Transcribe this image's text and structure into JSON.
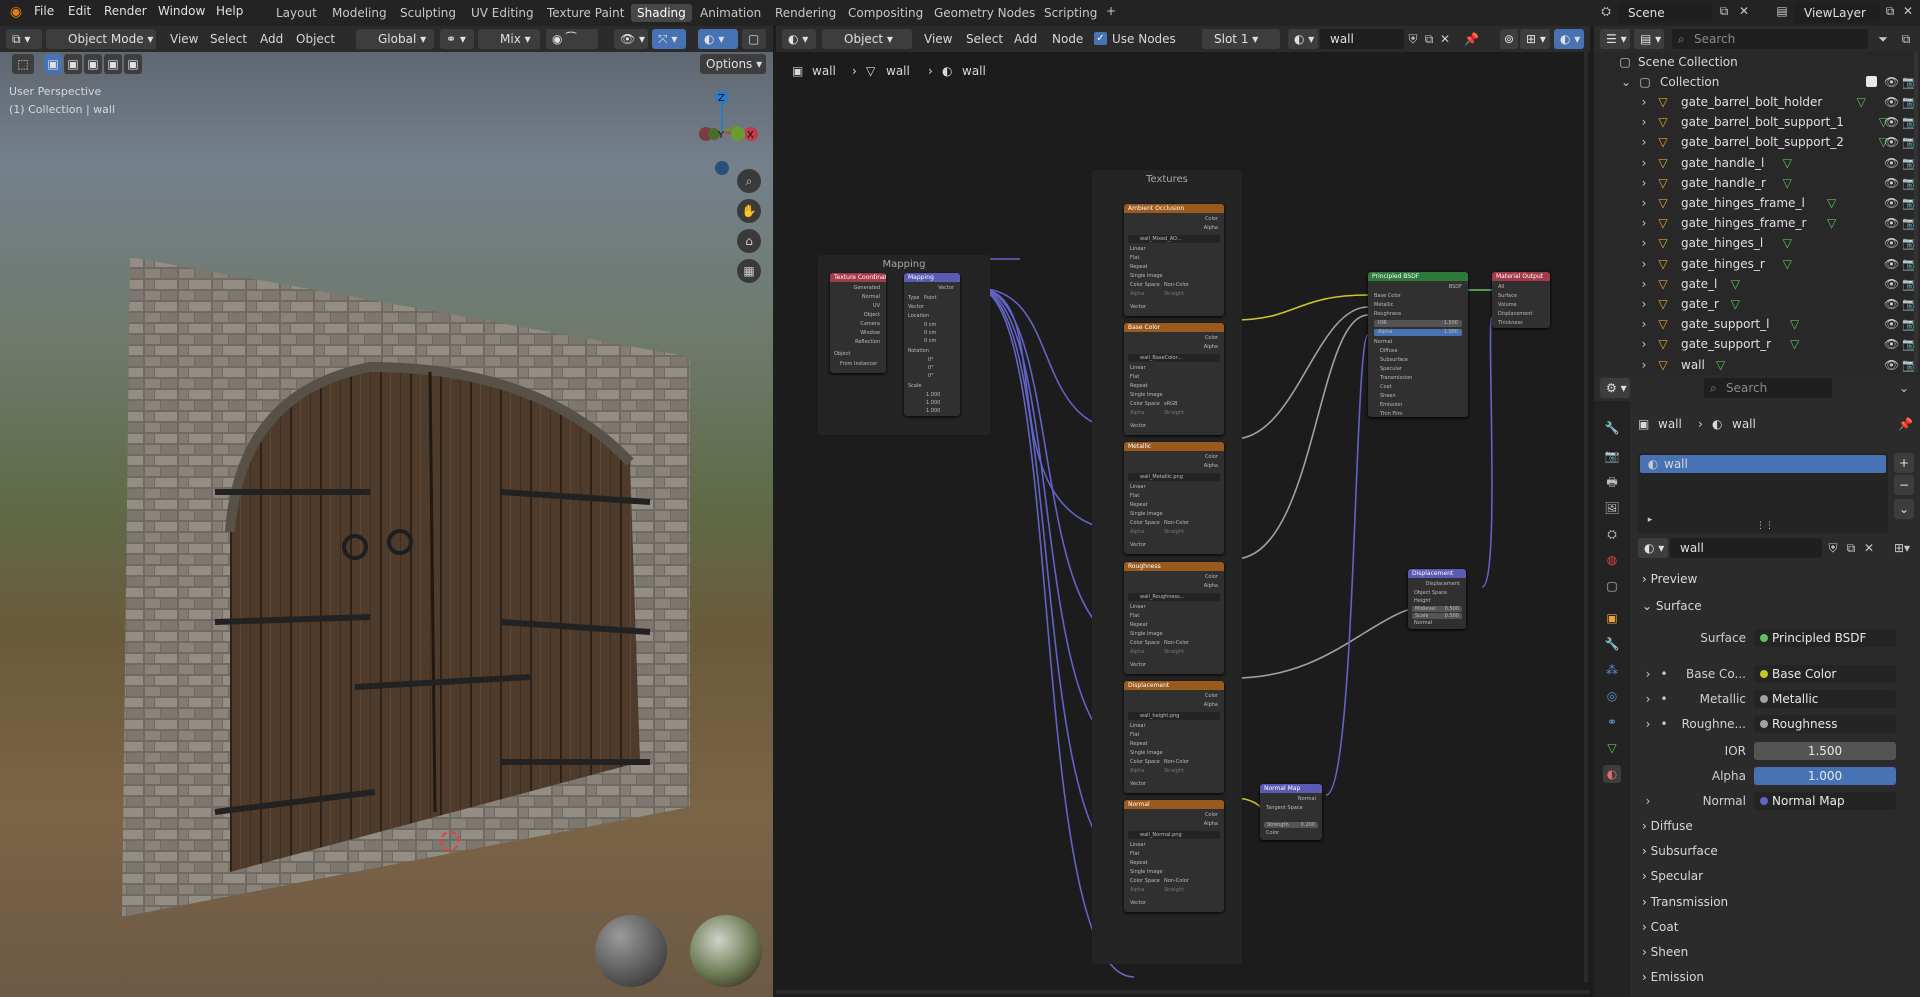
{
  "menus": [
    "File",
    "Edit",
    "Render",
    "Window",
    "Help"
  ],
  "workspaces": [
    {
      "label": "Layout"
    },
    {
      "label": "Modeling"
    },
    {
      "label": "Sculpting"
    },
    {
      "label": "UV Editing"
    },
    {
      "label": "Texture Paint"
    },
    {
      "label": "Shading"
    },
    {
      "label": "Animation"
    },
    {
      "label": "Rendering"
    },
    {
      "label": "Compositing"
    },
    {
      "label": "Geometry Nodes"
    },
    {
      "label": "Scripting"
    }
  ],
  "active_workspace": "Shading",
  "scene": {
    "name": "Scene",
    "view_layer": "ViewLayer"
  },
  "viewport": {
    "mode": "Object Mode",
    "menus": [
      "View",
      "Select",
      "Add",
      "Object"
    ],
    "orientation": "Global",
    "pivot": "Mix",
    "options": "Options",
    "overlay_line1": "User Perspective",
    "overlay_line2": "(1) Collection | wall",
    "gizmo": {
      "z": "Z",
      "y": "Y",
      "x": "X"
    }
  },
  "node_editor": {
    "type": "Object",
    "menus": [
      "View",
      "Select",
      "Add",
      "Node"
    ],
    "use_nodes_label": "Use Nodes",
    "slot": "Slot 1",
    "material": "wall",
    "breadcrumb": [
      "wall",
      "wall",
      "wall"
    ],
    "frames": {
      "mapping": "Mapping",
      "textures": "Textures"
    },
    "nodes": {
      "tex_coord": {
        "title": "Texture Coordinate",
        "outputs": [
          "Generated",
          "Normal",
          "UV",
          "Object",
          "Camera",
          "Window",
          "Reflection"
        ],
        "object_label": "Object",
        "instancer": "From Instancer"
      },
      "mapping": {
        "title": "Mapping",
        "output": "Vector",
        "type_label": "Type",
        "type_value": "Point",
        "vector": "Vector",
        "location": "Location",
        "loc": [
          "0 cm",
          "0 cm",
          "0 cm"
        ],
        "rotation": "Rotation",
        "rot": [
          "0°",
          "0°",
          "0°"
        ],
        "scale": "Scale",
        "scl": [
          "1.000",
          "1.000",
          "1.000"
        ]
      },
      "textures": [
        {
          "title": "Ambient Occlusion",
          "file": "wall_Mixed_AO...",
          "colorspace": "Non-Color"
        },
        {
          "title": "Base Color",
          "file": "wall_BaseColor...",
          "colorspace": "sRGB"
        },
        {
          "title": "Metallic",
          "file": "wall_Metallic.png",
          "colorspace": "Non-Color"
        },
        {
          "title": "Roughness",
          "file": "wall_Roughness...",
          "colorspace": "Non-Color"
        },
        {
          "title": "Displacement",
          "file": "wall_height.png",
          "colorspace": "Non-Color"
        },
        {
          "title": "Normal",
          "file": "wall_Normal.png",
          "colorspace": "Non-Color"
        }
      ],
      "tex_rows": {
        "color": "Color",
        "alpha": "Alpha",
        "linear": "Linear",
        "flat": "Flat",
        "repeat": "Repeat",
        "single": "Single Image",
        "cs": "Color Space",
        "alpha_mode": "Alpha",
        "straight": "Straight",
        "vector": "Vector"
      },
      "bsdf": {
        "title": "Principled BSDF",
        "out": "BSDF",
        "inputs": [
          "Base Color",
          "Metallic",
          "Roughness"
        ],
        "ior_label": "IOR",
        "ior": "1.500",
        "alpha_label": "Alpha",
        "alpha": "1.000",
        "normal": "Normal",
        "panels": [
          "Diffuse",
          "Subsurface",
          "Specular",
          "Transmission",
          "Coat",
          "Sheen",
          "Emission",
          "Thin Film"
        ]
      },
      "output": {
        "title": "Material Output",
        "target": "All",
        "inputs": [
          "Surface",
          "Volume",
          "Displacement",
          "Thickness"
        ]
      },
      "displacement": {
        "title": "Displacement",
        "out": "Displacement",
        "space": "Object Space",
        "height": "Height",
        "midlevel_label": "Midlevel",
        "midlevel": "0.500",
        "scale_label": "Scale",
        "scale": "0.500",
        "normal": "Normal"
      },
      "normal_map": {
        "title": "Normal Map",
        "out": "Normal",
        "space": "Tangent Space",
        "strength_label": "Strength",
        "strength": "0.200",
        "color": "Color"
      }
    }
  },
  "outliner": {
    "search_placeholder": "Search",
    "scene_collection": "Scene Collection",
    "collection": "Collection",
    "objects": [
      "gate_barrel_bolt_holder",
      "gate_barrel_bolt_support_1",
      "gate_barrel_bolt_support_2",
      "gate_handle_l",
      "gate_handle_r",
      "gate_hinges_frame_l",
      "gate_hinges_frame_r",
      "gate_hinges_l",
      "gate_hinges_r",
      "gate_l",
      "gate_r",
      "gate_support_l",
      "gate_support_r",
      "wall"
    ]
  },
  "properties": {
    "search_placeholder": "Search",
    "breadcrumb": [
      "wall",
      "wall"
    ],
    "slot_item": "wall",
    "material_name": "wall",
    "sections": {
      "preview": "Preview",
      "surface": "Surface"
    },
    "surface_label": "Surface",
    "surface_value": "Principled BSDF",
    "rows": [
      {
        "label": "Base Co...",
        "value": "Base Color",
        "dot": "#c7c729"
      },
      {
        "label": "Metallic",
        "value": "Metallic",
        "dot": "#a1a1a1"
      },
      {
        "label": "Roughne...",
        "value": "Roughness",
        "dot": "#a1a1a1"
      }
    ],
    "ior_label": "IOR",
    "ior": "1.500",
    "alpha_label": "Alpha",
    "alpha": "1.000",
    "normal_label": "Normal",
    "normal_value": "Normal Map",
    "panels": [
      "Diffuse",
      "Subsurface",
      "Specular",
      "Transmission",
      "Coat",
      "Sheen",
      "Emission"
    ]
  }
}
